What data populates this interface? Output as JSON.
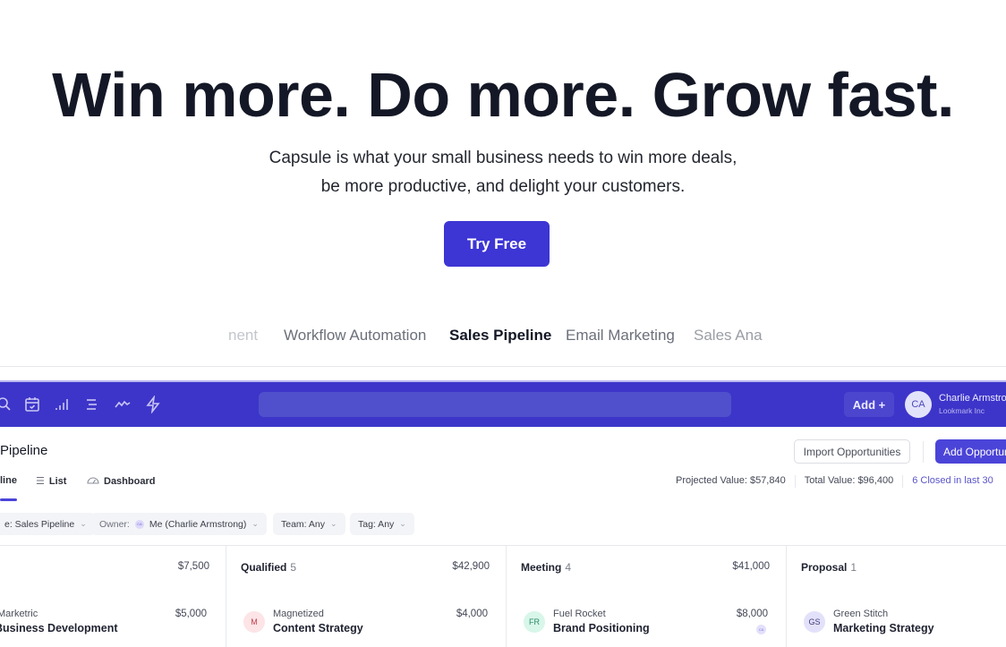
{
  "hero": {
    "title": "Win more. Do more. Grow fast.",
    "subtitle_line1": "Capsule is what your small business needs to win more deals,",
    "subtitle_line2": "be more productive, and delight your customers.",
    "cta_label": "Try Free"
  },
  "feature_tabs": [
    {
      "label": "nent",
      "active": false
    },
    {
      "label": "Workflow Automation",
      "active": false
    },
    {
      "label": "Sales Pipeline",
      "active": true
    },
    {
      "label": "Email Marketing",
      "active": false
    },
    {
      "label": "Sales Ana",
      "active": false
    }
  ],
  "app": {
    "topbar": {
      "icons": [
        "search-icon",
        "calendar-icon",
        "reports-icon",
        "list-icon",
        "activity-icon",
        "workflow-icon"
      ],
      "add_label": "Add +",
      "user_initials": "CA",
      "user_name": "Charlie Armstrong",
      "user_org": "Lookmark Inc"
    },
    "page_title": "Pipeline",
    "import_label": "Import Opportunities",
    "add_opportunity_label": "Add Opportunity",
    "view_tabs": [
      {
        "label": "line",
        "active": true
      },
      {
        "label": "List",
        "active": false
      },
      {
        "label": "Dashboard",
        "active": false
      }
    ],
    "stats": {
      "projected": "Projected Value: $57,840",
      "total": "Total Value: $96,400",
      "closed": "6 Closed in last 30"
    },
    "filters": [
      {
        "label": "",
        "value": "e: Sales Pipeline"
      },
      {
        "label": "Owner:",
        "value": "Me (Charlie Armstrong)",
        "avatar": "CA"
      },
      {
        "label": "",
        "value": "Team: Any"
      },
      {
        "label": "",
        "value": "Tag: Any"
      }
    ],
    "columns": [
      {
        "name": "",
        "count": "",
        "total": "$7,500",
        "card": {
          "initials": "",
          "company": "Marketric",
          "title": "Business Development",
          "value": "$5,000"
        }
      },
      {
        "name": "Qualified",
        "count": "5",
        "total": "$42,900",
        "card": {
          "initials": "M",
          "company": "Magnetized",
          "title": "Content Strategy",
          "value": "$4,000"
        }
      },
      {
        "name": "Meeting",
        "count": "4",
        "total": "$41,000",
        "card": {
          "initials": "FR",
          "company": "Fuel Rocket",
          "title": "Brand Positioning",
          "value": "$8,000",
          "owner": "CA"
        }
      },
      {
        "name": "Proposal",
        "count": "1",
        "total": "",
        "card": {
          "initials": "GS",
          "company": "Green Stitch",
          "title": "Marketing Strategy",
          "value": ""
        }
      }
    ]
  },
  "colors": {
    "brand": "#3d35d4",
    "app_bar": "#3d35c9",
    "text_dark": "#141826"
  }
}
